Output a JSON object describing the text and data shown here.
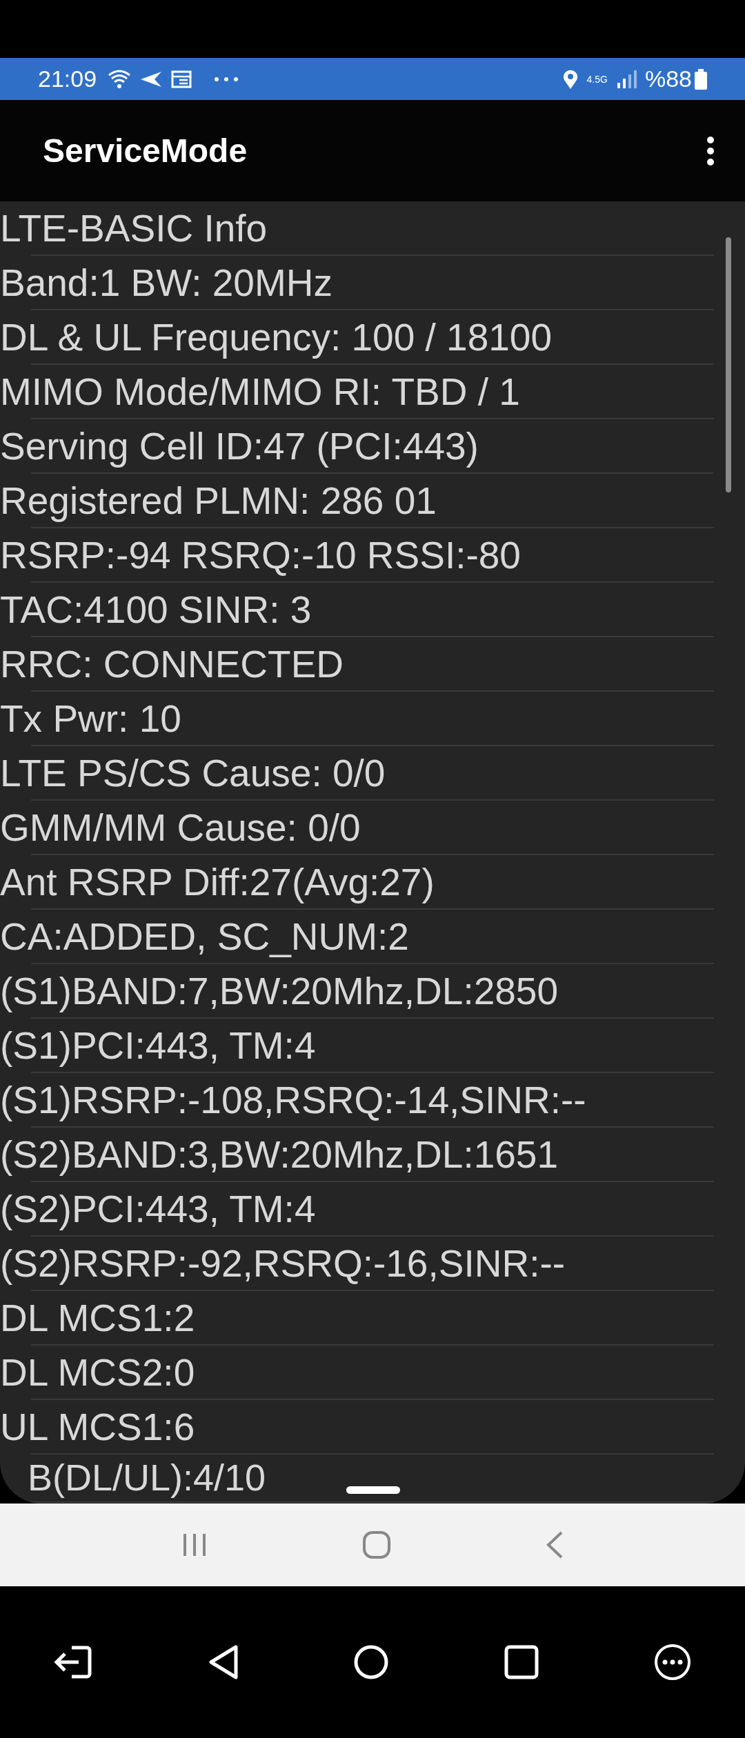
{
  "status_bar": {
    "time": "21:09",
    "network": "4.5G",
    "battery": "%88"
  },
  "app_bar": {
    "title": "ServiceMode"
  },
  "rows": [
    "LTE-BASIC Info",
    "Band:1 BW: 20MHz",
    "DL & UL Frequency: 100 / 18100",
    "MIMO Mode/MIMO RI: TBD / 1",
    "Serving Cell ID:47 (PCI:443)",
    "Registered PLMN: 286 01",
    "RSRP:-94 RSRQ:-10 RSSI:-80",
    "TAC:4100 SINR: 3",
    "RRC: CONNECTED",
    "Tx Pwr: 10",
    "LTE PS/CS Cause: 0/0",
    "GMM/MM Cause: 0/0",
    "Ant RSRP Diff:27(Avg:27)",
    "CA:ADDED, SC_NUM:2",
    "(S1)BAND:7,BW:20Mhz,DL:2850",
    "(S1)PCI:443, TM:4",
    "(S1)RSRP:-108,RSRQ:-14,SINR:--",
    "(S2)BAND:3,BW:20Mhz,DL:1651",
    "(S2)PCI:443, TM:4",
    "(S2)RSRP:-92,RSRQ:-16,SINR:--",
    "DL MCS1:2",
    "DL MCS2:0",
    "UL MCS1:6",
    "B(DL/UL):4/10"
  ]
}
